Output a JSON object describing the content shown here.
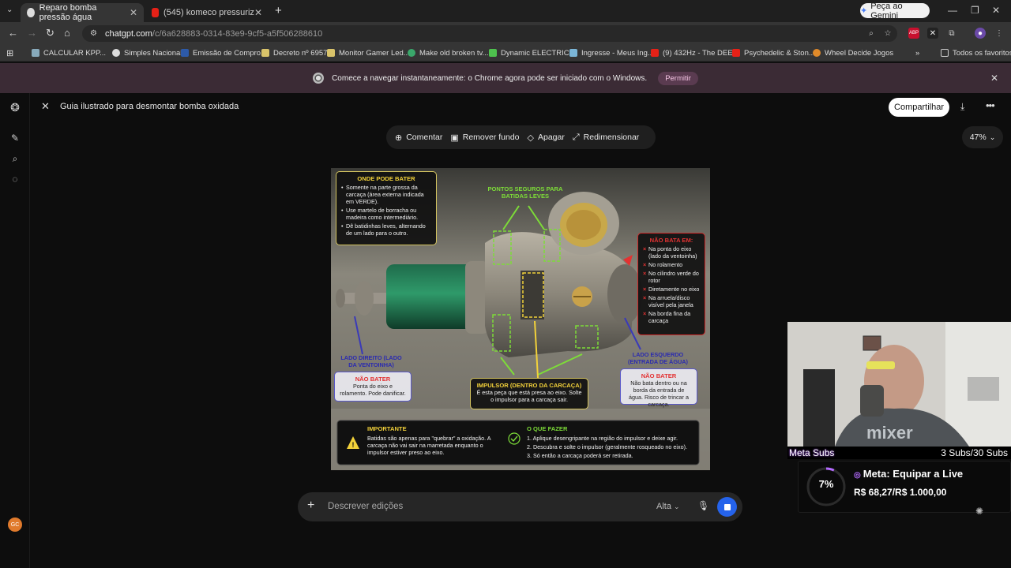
{
  "browser": {
    "tabs": [
      {
        "title": "Reparo bomba pressão água",
        "close": "✕"
      },
      {
        "title": "(545) komeco pressurizador - Y",
        "close": "✕"
      }
    ],
    "new_tab": "+",
    "gemini_button": "Peça ao Gemini",
    "url_host": "chatgpt.com",
    "url_path": "/c/6a628883-0314-83e9-9cf5-a5f506288610",
    "bookmarks": [
      "CALCULAR KPP...",
      "Simples Nacional",
      "Emissão de Compro...",
      "Decreto nº 6957",
      "Monitor Gamer Led...",
      "Make old broken tv...",
      "Dynamic ELECTRIC...",
      "Ingresse - Meus Ing...",
      "(9) 432Hz - The DEE...",
      "Psychedelic & Ston...",
      "Wheel Decide Jogos"
    ],
    "bookmarks_more": "»",
    "all_favorites": "Todos os favoritos",
    "infobar_text": "Comece a navegar instantaneamente: o Chrome agora pode ser iniciado com o Windows.",
    "infobar_button": "Permitir"
  },
  "chat": {
    "title": "Guia ilustrado para desmontar bomba oxidada",
    "share": "Compartilhar",
    "tools": [
      {
        "icon": "⊕",
        "label": "Comentar"
      },
      {
        "icon": "▣",
        "label": "Remover fundo"
      },
      {
        "icon": "◇",
        "label": "Apagar"
      },
      {
        "icon": "⤢",
        "label": "Redimensionar"
      }
    ],
    "zoom": "47%",
    "composer_placeholder": "Descrever edições",
    "quality": "Alta",
    "avatar_initials": "GC"
  },
  "infographic": {
    "onde_title": "ONDE PODE BATER",
    "onde_items": [
      "Somente na parte grossa da carcaça (área externa indicada em VERDE).",
      "Use martelo de borracha ou madeira como intermediário.",
      "Dê batidinhas leves, alternando de um lado para o outro."
    ],
    "pontos_title": "PONTOS SEGUROS PARA BATIDAS LEVES",
    "nao_bata_title": "NÃO BATA EM:",
    "nao_bata_items": [
      "Na ponta do eixo (lado da ventoinha)",
      "No rolamento",
      "No cilindro verde do rotor",
      "Diretamente no eixo",
      "Na arruela/disco visível pela janela",
      "Na borda fina da carcaça"
    ],
    "lado_direito": "LADO DIREITO (LADO DA VENTOINHA)",
    "lado_esquerdo": "LADO ESQUERDO (ENTRADA DE ÁGUA)",
    "nao_bater_left_title": "NÃO BATER",
    "nao_bater_left_text": "Ponta do eixo e rolamento. Pode danificar.",
    "nao_bater_right_title": "NÃO BATER",
    "nao_bater_right_text": "Não bata dentro ou na borda da entrada de água. Risco de trincar a carcaça.",
    "impulsor_title": "IMPULSOR (DENTRO DA CARCAÇA)",
    "impulsor_text": "É esta peça que está presa ao eixo. Solte o impulsor para a carcaça sair.",
    "importante_title": "IMPORTANTE",
    "importante_text": "Batidas são apenas para \"quebrar\" a oxidação. A carcaça não vai sair na marretada enquanto o impulsor estiver preso ao eixo.",
    "o_que_title": "O QUE FAZER",
    "o_que_items": [
      "1. Aplique desengripante na região do impulsor e deixe agir.",
      "2. Descubra e solte o impulsor (geralmente rosqueado no eixo).",
      "3. Só então a carcaça poderá ser retirada."
    ]
  },
  "stream": {
    "meta_subs_label": "Meta Subs",
    "subs_count": "3 Subs/30 Subs",
    "goal_percent": "7%",
    "goal_fraction": 0.07,
    "goal_title": "Meta: Equipar a Live",
    "goal_amount": "R$ 68,27/R$ 1.000,00",
    "webcam_shirt_text": "mixer"
  },
  "colors": {
    "accent_blue": "#2563eb",
    "safe_green": "#7ddc38",
    "danger_red": "#e33232",
    "highlight_yellow": "#f2d13a"
  }
}
